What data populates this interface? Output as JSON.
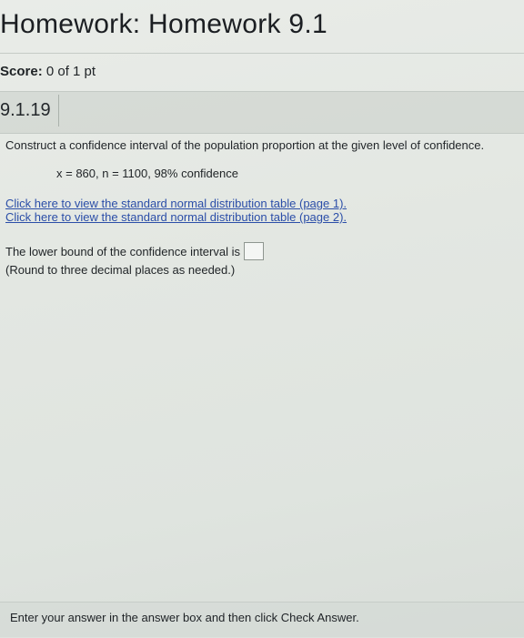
{
  "header": {
    "title": "Homework: Homework 9.1"
  },
  "score": {
    "label": "Score:",
    "value": "0 of 1 pt"
  },
  "question": {
    "id": "9.1.19",
    "prompt": "Construct a confidence interval of the population proportion at the given level of confidence.",
    "givens": "x = 860, n = 1100, 98% confidence",
    "links": [
      "Click here to view the standard normal distribution table (page 1).",
      "Click here to view the standard normal distribution table (page 2)."
    ],
    "answer_prompt": "The lower bound of the confidence interval is",
    "answer_value": "",
    "hint": "(Round to three decimal places as needed.)"
  },
  "footer": {
    "instruction": "Enter your answer in the answer box and then click Check Answer."
  }
}
